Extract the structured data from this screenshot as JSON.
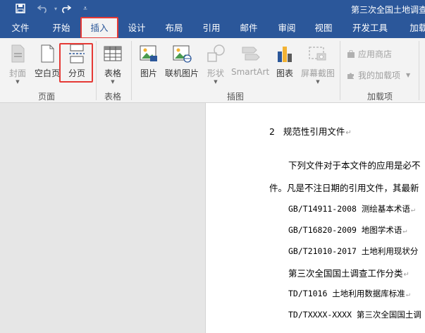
{
  "titlebar": {
    "doc_title": "第三次全国土地调查",
    "qat": {
      "save_icon": "save-icon",
      "undo_icon": "undo-icon",
      "redo_icon": "redo-icon",
      "customize_icon": "customize-qat-icon"
    }
  },
  "tabs": [
    {
      "label": "文件"
    },
    {
      "label": "开始"
    },
    {
      "label": "插入",
      "active": true
    },
    {
      "label": "设计"
    },
    {
      "label": "布局"
    },
    {
      "label": "引用"
    },
    {
      "label": "邮件"
    },
    {
      "label": "审阅"
    },
    {
      "label": "视图"
    },
    {
      "label": "开发工具"
    },
    {
      "label": "加载项"
    }
  ],
  "ribbon": {
    "groups": {
      "pages": "页面",
      "tables": "表格",
      "illustrations": "插图",
      "addins": "加载项"
    },
    "buttons": {
      "cover": "封面",
      "blank_page": "空白页",
      "page_break": "分页",
      "table": "表格",
      "picture": "图片",
      "online_picture": "联机图片",
      "shapes": "形状",
      "smartart": "SmartArt",
      "chart": "图表",
      "screenshot": "屏幕截图",
      "store": "应用商店",
      "my_addins": "我的加载项"
    }
  },
  "document": {
    "heading_num": "2",
    "heading": "规范性引用文件",
    "para1": "下列文件对于本文件的应用是必不",
    "para2": "件。凡是不注日期的引用文件，其最新",
    "refs": [
      "GB/T14911-2008 测绘基本术语",
      "GB/T16820-2009 地图学术语",
      "GB/T21010-2017 土地利用现状分",
      "第三次全国国土调查工作分类",
      "TD/T1016 土地利用数据库标准",
      "TD/TXXXX-XXXX 第三次全国国土调"
    ],
    "para_mark": "↵"
  },
  "colors": {
    "brand": "#2b579a",
    "highlight": "#e53935"
  }
}
